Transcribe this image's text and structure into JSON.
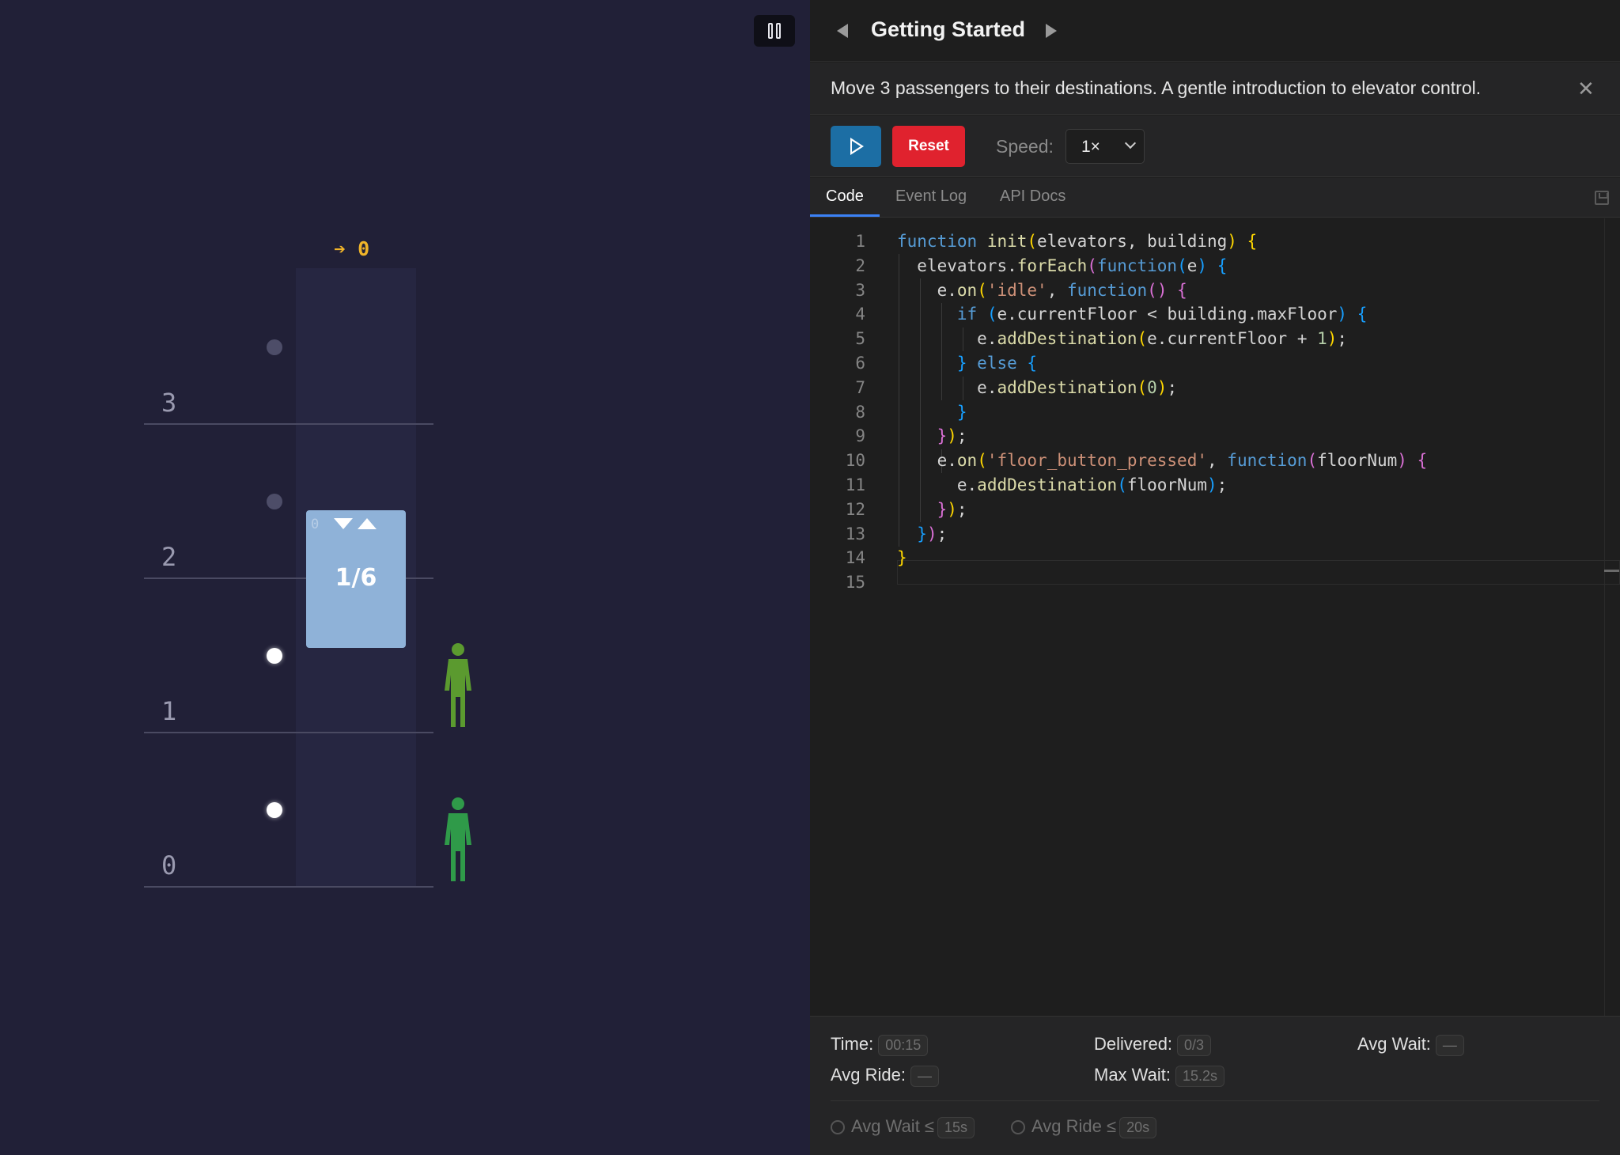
{
  "simulation": {
    "destination_indicator": "➔ 0",
    "floors": [
      "3",
      "2",
      "1",
      "0"
    ],
    "elevator": {
      "floor_label": "0",
      "load": "1/6",
      "direction_down_lit": true,
      "direction_up_lit": true
    },
    "call_buttons": [
      {
        "floor": "3",
        "active": false
      },
      {
        "floor": "2",
        "active": false
      },
      {
        "floor": "1",
        "active": true
      },
      {
        "floor": "0",
        "active": true
      }
    ],
    "passengers": [
      {
        "floor": "1",
        "color": "#5b9a2f"
      },
      {
        "floor": "0",
        "color": "#2f9a49"
      }
    ],
    "colors": {
      "background": "#212037",
      "car": "#8fb2d8",
      "destination": "#f0b429"
    }
  },
  "header": {
    "layout_toggle_icon": "columns-icon",
    "title": "Getting Started",
    "description": "Move 3 passengers to their destinations. A gentle introduction to elevator control."
  },
  "controls": {
    "play_icon": "play-icon",
    "reset_label": "Reset",
    "speed_label": "Speed:",
    "speed_value": "1×"
  },
  "tabs": [
    {
      "label": "Code",
      "active": true
    },
    {
      "label": "Event Log",
      "active": false
    },
    {
      "label": "API Docs",
      "active": false
    }
  ],
  "editor": {
    "line_numbers": [
      "1",
      "2",
      "3",
      "4",
      "5",
      "6",
      "7",
      "8",
      "9",
      "10",
      "11",
      "12",
      "13",
      "14",
      "15"
    ],
    "lines": [
      "function init(elevators, building) {",
      "  elevators.forEach(function(e) {",
      "    e.on('idle', function() {",
      "      if (e.currentFloor < building.maxFloor) {",
      "        e.addDestination(e.currentFloor + 1);",
      "      } else {",
      "        e.addDestination(0);",
      "      }",
      "    });",
      "    e.on('floor_button_pressed', function(floorNum) {",
      "      e.addDestination(floorNum);",
      "    });",
      "  });",
      "}",
      ""
    ]
  },
  "stats": {
    "time_label": "Time:",
    "time_value": "00:15",
    "delivered_label": "Delivered:",
    "delivered_value": "0/3",
    "avg_wait_label": "Avg Wait:",
    "avg_wait_value": "—",
    "avg_ride_label": "Avg Ride:",
    "avg_ride_value": "—",
    "max_wait_label": "Max Wait:",
    "max_wait_value": "15.2s"
  },
  "goals": [
    {
      "label": "Avg Wait ≤",
      "value": "15s"
    },
    {
      "label": "Avg Ride ≤",
      "value": "20s"
    }
  ]
}
